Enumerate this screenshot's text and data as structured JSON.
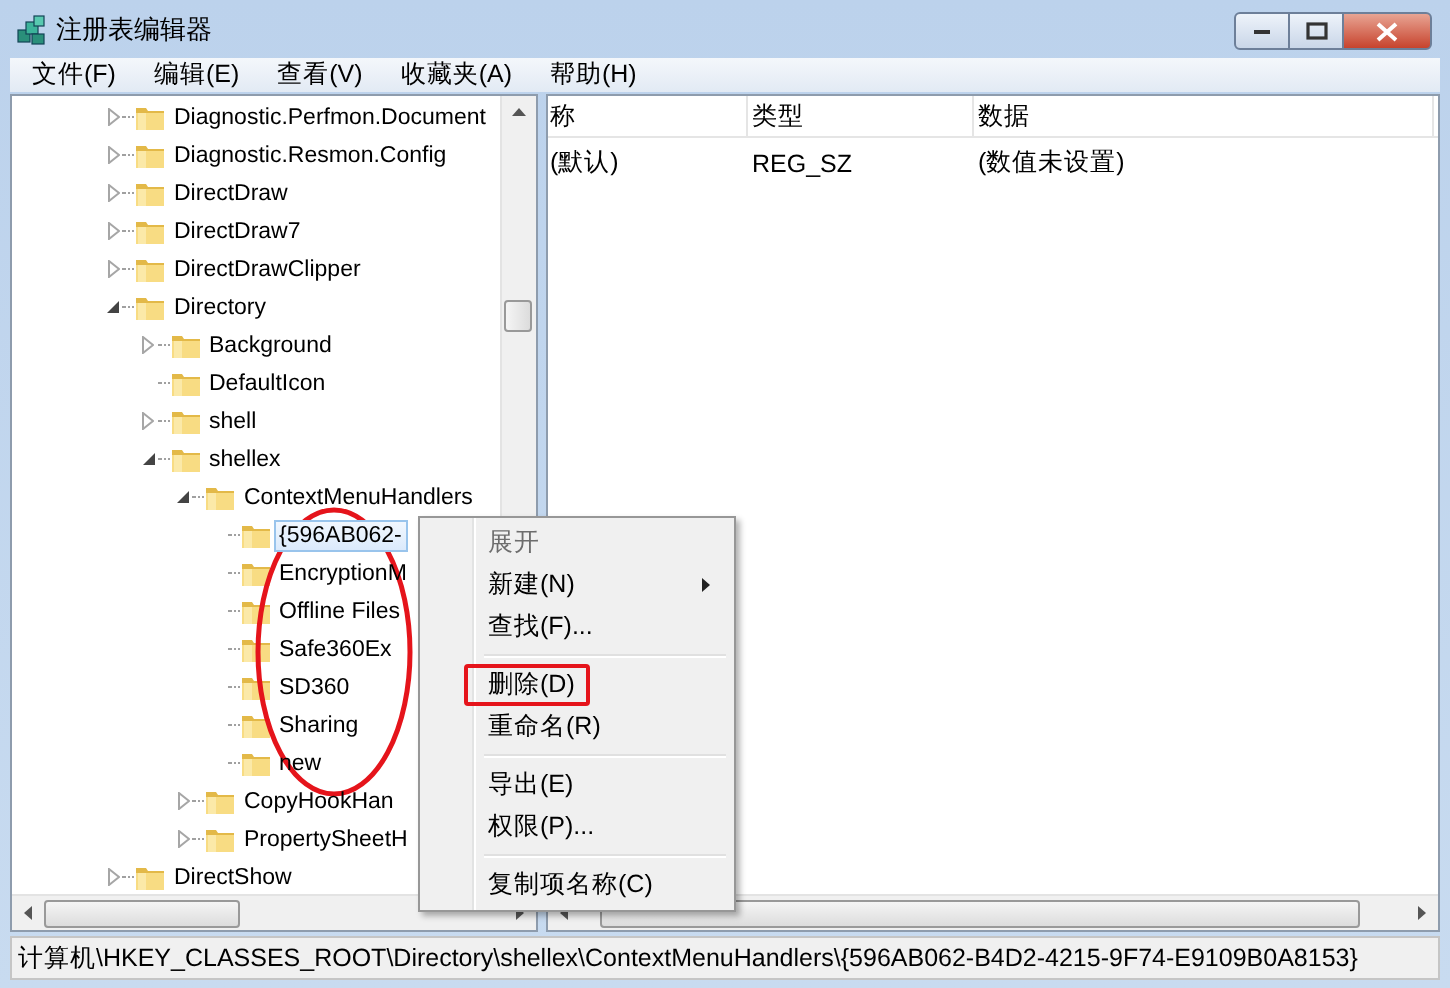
{
  "window": {
    "title": "注册表编辑器"
  },
  "menu_bar": [
    {
      "label": "文件(F)"
    },
    {
      "label": "编辑(E)"
    },
    {
      "label": "查看(V)"
    },
    {
      "label": "收藏夹(A)"
    },
    {
      "label": "帮助(H)"
    }
  ],
  "tree": {
    "items": [
      {
        "label": "Diagnostic.Perfmon.Document",
        "kind": "node",
        "expanded": false,
        "selected": false
      },
      {
        "label": "Diagnostic.Resmon.Config",
        "kind": "node",
        "expanded": false,
        "selected": false
      },
      {
        "label": "DirectDraw",
        "kind": "node",
        "expanded": false,
        "selected": false
      },
      {
        "label": "DirectDraw7",
        "kind": "node",
        "expanded": false,
        "selected": false
      },
      {
        "label": "DirectDrawClipper",
        "kind": "node",
        "expanded": false,
        "selected": false
      },
      {
        "label": "Directory",
        "kind": "node",
        "expanded": true,
        "selected": false,
        "children": [
          {
            "label": "Background",
            "kind": "node",
            "expanded": false,
            "selected": false
          },
          {
            "label": "DefaultIcon",
            "kind": "leaf",
            "selected": false
          },
          {
            "label": "shell",
            "kind": "node",
            "expanded": false,
            "selected": false
          },
          {
            "label": "shellex",
            "kind": "node",
            "expanded": true,
            "selected": false,
            "children": [
              {
                "label": "ContextMenuHandlers",
                "kind": "node",
                "expanded": true,
                "selected": false,
                "children": [
                  {
                    "label": "{596AB062-",
                    "kind": "leaf",
                    "selected": true
                  },
                  {
                    "label": "EncryptionM",
                    "kind": "leaf",
                    "selected": false
                  },
                  {
                    "label": "Offline Files",
                    "kind": "leaf",
                    "selected": false
                  },
                  {
                    "label": "Safe360Ex",
                    "kind": "leaf",
                    "selected": false
                  },
                  {
                    "label": "SD360",
                    "kind": "leaf",
                    "selected": false
                  },
                  {
                    "label": "Sharing",
                    "kind": "leaf",
                    "selected": false
                  },
                  {
                    "label": "new",
                    "kind": "leaf",
                    "selected": false
                  }
                ]
              },
              {
                "label": "CopyHookHan",
                "kind": "node",
                "expanded": false,
                "selected": false
              },
              {
                "label": "PropertySheetH",
                "kind": "node",
                "expanded": false,
                "selected": false
              }
            ]
          }
        ]
      },
      {
        "label": "DirectShow",
        "kind": "node",
        "expanded": false,
        "selected": false
      }
    ]
  },
  "values_table": {
    "columns": [
      "称",
      "类型",
      "数据"
    ],
    "rows": [
      [
        "(默认)",
        "REG_SZ",
        "(数值未设置)"
      ]
    ]
  },
  "context_menu": [
    {
      "kind": "item",
      "label": "展开",
      "disabled": true,
      "submenu": false
    },
    {
      "kind": "item",
      "label": "新建(N)",
      "disabled": false,
      "submenu": true
    },
    {
      "kind": "item",
      "label": "查找(F)...",
      "disabled": false,
      "submenu": false
    },
    {
      "kind": "separator"
    },
    {
      "kind": "item",
      "label": "删除(D)",
      "disabled": false,
      "submenu": false
    },
    {
      "kind": "item",
      "label": "重命名(R)",
      "disabled": false,
      "submenu": false
    },
    {
      "kind": "separator"
    },
    {
      "kind": "item",
      "label": "导出(E)",
      "disabled": false,
      "submenu": false
    },
    {
      "kind": "item",
      "label": "权限(P)...",
      "disabled": false,
      "submenu": false
    },
    {
      "kind": "separator"
    },
    {
      "kind": "item",
      "label": "复制项名称(C)",
      "disabled": false,
      "submenu": false
    }
  ],
  "status_bar": "计算机\\HKEY_CLASSES_ROOT\\Directory\\shellex\\ContextMenuHandlers\\{596AB062-B4D2-4215-9F74-E9109B0A8153}"
}
